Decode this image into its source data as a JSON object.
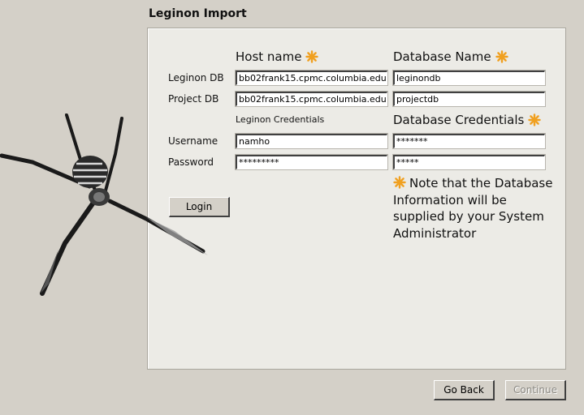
{
  "window": {
    "title": "Leginon Import"
  },
  "columns": {
    "host_name": "Host name",
    "database_name": "Database Name"
  },
  "rows": {
    "leginon_db": {
      "label": "Leginon DB",
      "host": "bb02frank15.cpmc.columbia.edu",
      "database": "leginondb"
    },
    "project_db": {
      "label": "Project DB",
      "host": "bb02frank15.cpmc.columbia.edu",
      "database": "projectdb"
    }
  },
  "credentials": {
    "leginon_header": "Leginon Credentials",
    "database_header": "Database Credentials",
    "username_label": "Username",
    "password_label": "Password",
    "leginon_username": "namho",
    "leginon_password": "*********",
    "database_username": "*******",
    "database_password": "*****"
  },
  "buttons": {
    "login": "Login",
    "go_back": "Go Back",
    "continue": "Continue"
  },
  "note": "Note that the Database Information will be supplied by your System Administrator",
  "icons": {
    "required": "asterisk-icon",
    "logo": "spider-icon"
  },
  "colors": {
    "asterisk": "#f0a020",
    "background": "#d4d0c8",
    "panel": "#ecebe6"
  }
}
